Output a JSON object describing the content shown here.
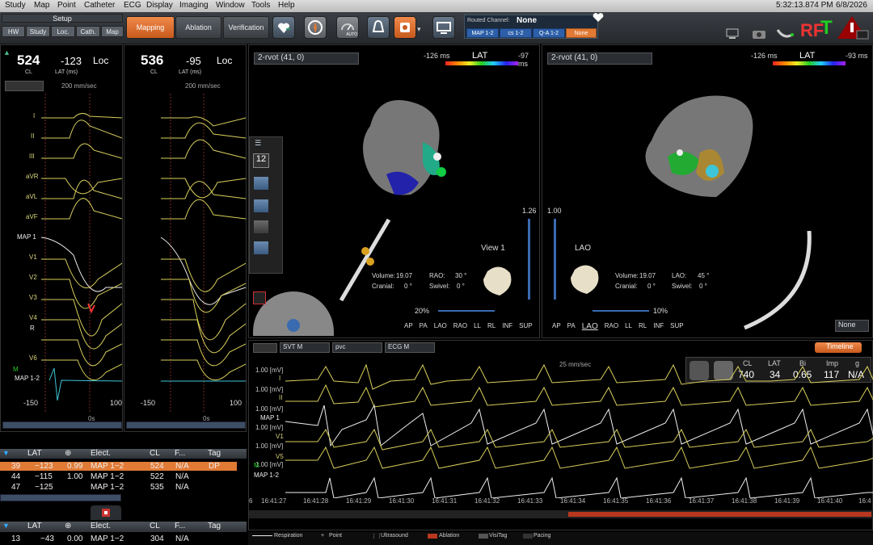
{
  "menu": {
    "items": [
      "Study",
      "Map",
      "Point",
      "Catheter",
      "ECG",
      "Display",
      "Imaging",
      "Window",
      "Tools",
      "Help"
    ],
    "clock": "5:32:13.874 PM",
    "date": "6/8/2026"
  },
  "toolbar": {
    "setup_label": "Setup",
    "setup_tabs": [
      "HW",
      "Study",
      "Loc.",
      "Cath.",
      "Map"
    ],
    "mode_tabs": [
      "Mapping",
      "Ablation",
      "Verification"
    ],
    "auto_label": "AUTO",
    "routed_channel_label": "Routed Channel:",
    "routed_channel_value": "None",
    "routed_tabs": [
      "MAP 1-2",
      "cs 1-2",
      "Q-A 1-2",
      "None"
    ]
  },
  "ecg_left": {
    "cl_value": "524",
    "cl_label": "CL",
    "lat_value": "-123",
    "lat_label": "LAT (ms)",
    "loc_label": "Loc",
    "speed": "200 mm/sec",
    "leads": [
      "I",
      "II",
      "III",
      "aVR",
      "aVL",
      "aVF",
      "MAP 1",
      "V1",
      "V2",
      "V3",
      "V4",
      "R",
      "V6",
      "M",
      "MAP 1-2"
    ],
    "scale_left": "-150",
    "scale_right": "100",
    "time_zero": "0s"
  },
  "ecg_right": {
    "cl_value": "536",
    "cl_label": "CL",
    "lat_value": "-95",
    "lat_label": "LAT (ms)",
    "loc_label": "Loc",
    "speed": "200 mm/sec",
    "scale_left": "-150",
    "scale_right": "100",
    "time_zero": "0s"
  },
  "map_left": {
    "map_name": "2-rvot (41, 0)",
    "scale_min": "-126 ms",
    "scale_label": "LAT",
    "scale_max": "-97 ms",
    "tool_count": "12",
    "threshold": "1.26",
    "view_label": "View 1",
    "volume_label": "Volume:",
    "volume_value": "19.07",
    "cranial_label": "Cranial:",
    "cranial_value": "0 °",
    "rao_label": "RAO:",
    "rao_value": "30 °",
    "swivel_label": "Swivel:",
    "swivel_value": "0 °",
    "opacity": "20%",
    "views": [
      "AP",
      "PA",
      "LAO",
      "RAO",
      "LL",
      "RL",
      "INF",
      "SUP"
    ]
  },
  "map_right": {
    "map_name": "2-rvot (41, 0)",
    "scale_min": "-126 ms",
    "scale_label": "LAT",
    "scale_max": "-93 ms",
    "threshold": "1.00",
    "view_label": "LAO",
    "volume_label": "Volume:",
    "volume_value": "19.07",
    "cranial_label": "Cranial:",
    "cranial_value": "0 °",
    "lao_label": "LAO:",
    "lao_value": "45 °",
    "swivel_label": "Swivel:",
    "swivel_value": "0 °",
    "opacity": "10%",
    "views": [
      "AP",
      "PA",
      "LAO",
      "RAO",
      "LL",
      "RL",
      "INF",
      "SUP"
    ],
    "dropdown": "None"
  },
  "point_table": {
    "headers": [
      "LAT",
      "",
      "Elect.",
      "CL",
      "F...",
      "Tag"
    ],
    "rows": [
      {
        "id": "39",
        "lat": "−123",
        "corr": "0.99",
        "elect": "MAP 1−2",
        "cl": "524",
        "f": "N/A",
        "tag": "DP"
      },
      {
        "id": "44",
        "lat": "−115",
        "corr": "1.00",
        "elect": "MAP 1−2",
        "cl": "522",
        "f": "N/A",
        "tag": ""
      },
      {
        "id": "47",
        "lat": "−125",
        "corr": "",
        "elect": "MAP 1−2",
        "cl": "535",
        "f": "N/A",
        "tag": ""
      }
    ]
  },
  "point_table2": {
    "headers": [
      "LAT",
      "",
      "Elect.",
      "CL",
      "F...",
      "Tag"
    ],
    "row": {
      "id": "13",
      "lat": "−43",
      "corr": "0.00",
      "elect": "MAP 1−2",
      "cl": "304",
      "f": "N/A",
      "tag": ""
    }
  },
  "bottom_ecg": {
    "channel1": "SVT M",
    "channel2": "pvc",
    "channel3": "ECG M",
    "speed": "25 mm/sec",
    "timeline_label": "Timeline",
    "cl_label": "CL",
    "cl_value": "740",
    "lat_label": "LAT",
    "lat_value": "34",
    "bi_label": "Bi",
    "bi_value": "0.65",
    "imp_label": "Imp",
    "imp_value": "117",
    "g_label": "g",
    "g_value": "N/A",
    "scales": [
      "1.00 [mV]",
      "1.00 [mV]",
      "1.00 [mV]",
      "1.00 [mV]",
      "1.00 [mV]",
      "1.00 [mV]"
    ],
    "leads": [
      "I",
      "II",
      "MAP 1",
      "V1",
      "V5",
      "M",
      "MAP 1-2"
    ],
    "times": [
      "6",
      "16:41:27",
      "16:41:28",
      "16:41:29",
      "16:41:30",
      "16:41:31",
      "16:41:32",
      "16:41:33",
      "16:41:34",
      "16:41:35",
      "16:41:36",
      "16:41:37",
      "16:41:38",
      "16:41:39",
      "16:41:40",
      "16:4"
    ]
  },
  "legend": {
    "items": [
      "Respiration",
      "Point",
      "Ultrasound",
      "Ablation",
      "VisiTag",
      "Pacing"
    ]
  },
  "colors": {
    "accent": "#e07a35",
    "ecg_yellow": "#d8cf5a",
    "ecg_white": "#f0f0f0",
    "map_cyan": "#3ec6d8"
  }
}
